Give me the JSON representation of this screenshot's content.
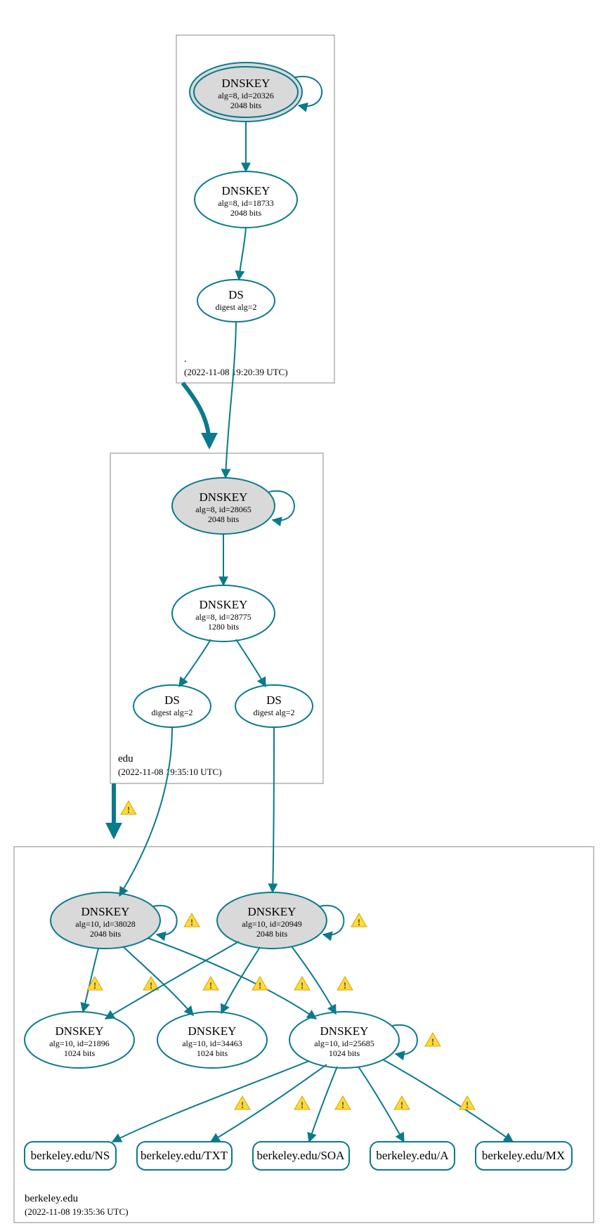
{
  "zones": {
    "root": {
      "label": ".",
      "timestamp": "(2022-11-08 19:20:39 UTC)"
    },
    "edu": {
      "label": "edu",
      "timestamp": "(2022-11-08 19:35:10 UTC)"
    },
    "berkeley": {
      "label": "berkeley.edu",
      "timestamp": "(2022-11-08 19:35:36 UTC)"
    }
  },
  "nodes": {
    "root_ksk": {
      "title": "DNSKEY",
      "sub1": "alg=8, id=20326",
      "sub2": "2048 bits"
    },
    "root_zsk": {
      "title": "DNSKEY",
      "sub1": "alg=8, id=18733",
      "sub2": "2048 bits"
    },
    "root_ds": {
      "title": "DS",
      "sub1": "digest alg=2",
      "sub2": ""
    },
    "edu_ksk": {
      "title": "DNSKEY",
      "sub1": "alg=8, id=28065",
      "sub2": "2048 bits"
    },
    "edu_zsk": {
      "title": "DNSKEY",
      "sub1": "alg=8, id=28775",
      "sub2": "1280 bits"
    },
    "edu_ds1": {
      "title": "DS",
      "sub1": "digest alg=2",
      "sub2": ""
    },
    "edu_ds2": {
      "title": "DS",
      "sub1": "digest alg=2",
      "sub2": ""
    },
    "bk_ksk1": {
      "title": "DNSKEY",
      "sub1": "alg=10, id=38028",
      "sub2": "2048 bits"
    },
    "bk_ksk2": {
      "title": "DNSKEY",
      "sub1": "alg=10, id=20949",
      "sub2": "2048 bits"
    },
    "bk_zsk1": {
      "title": "DNSKEY",
      "sub1": "alg=10, id=21896",
      "sub2": "1024 bits"
    },
    "bk_zsk2": {
      "title": "DNSKEY",
      "sub1": "alg=10, id=34463",
      "sub2": "1024 bits"
    },
    "bk_zsk3": {
      "title": "DNSKEY",
      "sub1": "alg=10, id=25685",
      "sub2": "1024 bits"
    },
    "rr_ns": {
      "title": "berkeley.edu/NS"
    },
    "rr_txt": {
      "title": "berkeley.edu/TXT"
    },
    "rr_soa": {
      "title": "berkeley.edu/SOA"
    },
    "rr_a": {
      "title": "berkeley.edu/A"
    },
    "rr_mx": {
      "title": "berkeley.edu/MX"
    }
  }
}
